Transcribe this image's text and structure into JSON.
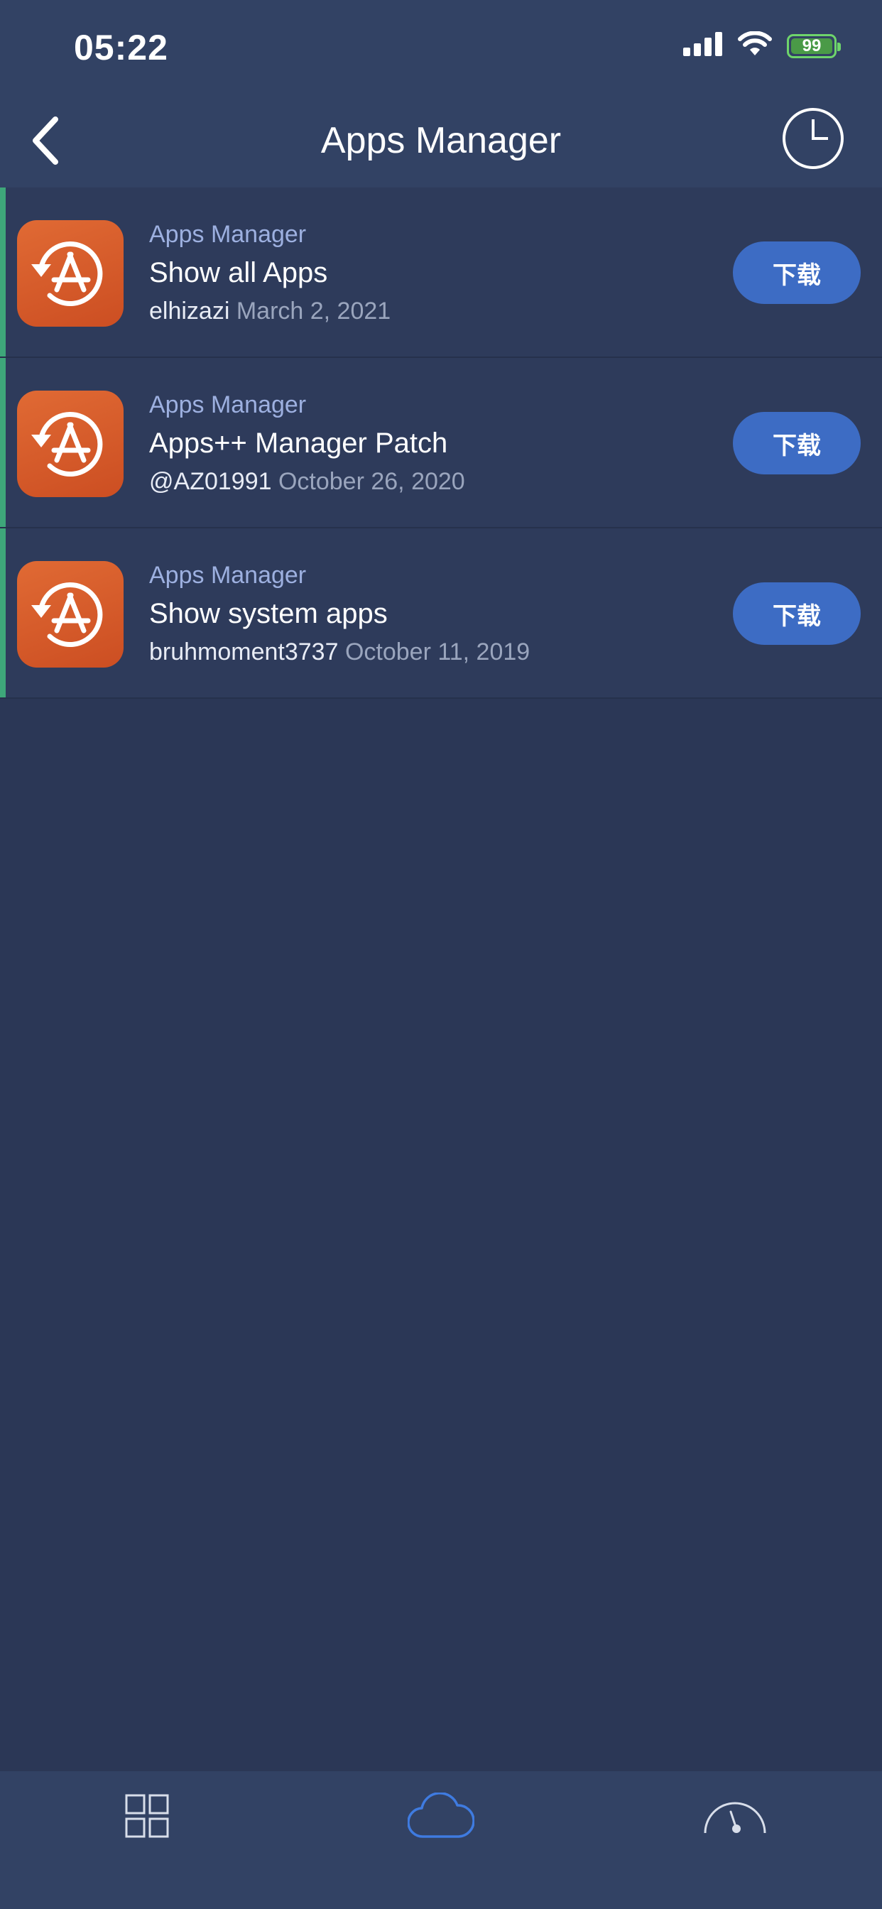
{
  "status_bar": {
    "time": "05:22",
    "battery": "99"
  },
  "nav": {
    "title": "Apps Manager"
  },
  "items": [
    {
      "category": "Apps Manager",
      "title": "Show all Apps",
      "author": "elhizazi",
      "date": "March 2, 2021",
      "button": "下载"
    },
    {
      "category": "Apps Manager",
      "title": "Apps++ Manager Patch",
      "author": "@AZ01991",
      "date": "October 26, 2020",
      "button": "下载"
    },
    {
      "category": "Apps Manager",
      "title": "Show system apps",
      "author": "bruhmoment3737",
      "date": "October 11, 2019",
      "button": "下载"
    }
  ],
  "tabs": [
    {
      "icon": "grid-icon",
      "active": false
    },
    {
      "icon": "cloud-icon",
      "active": true
    },
    {
      "icon": "speedometer-icon",
      "active": false
    }
  ],
  "colors": {
    "background": "#2b3756",
    "bar": "#324264",
    "accent": "#3ea77a",
    "button": "#3d6cc4",
    "icon_orange": "#e06a34",
    "active_tab": "#3f7be0"
  }
}
